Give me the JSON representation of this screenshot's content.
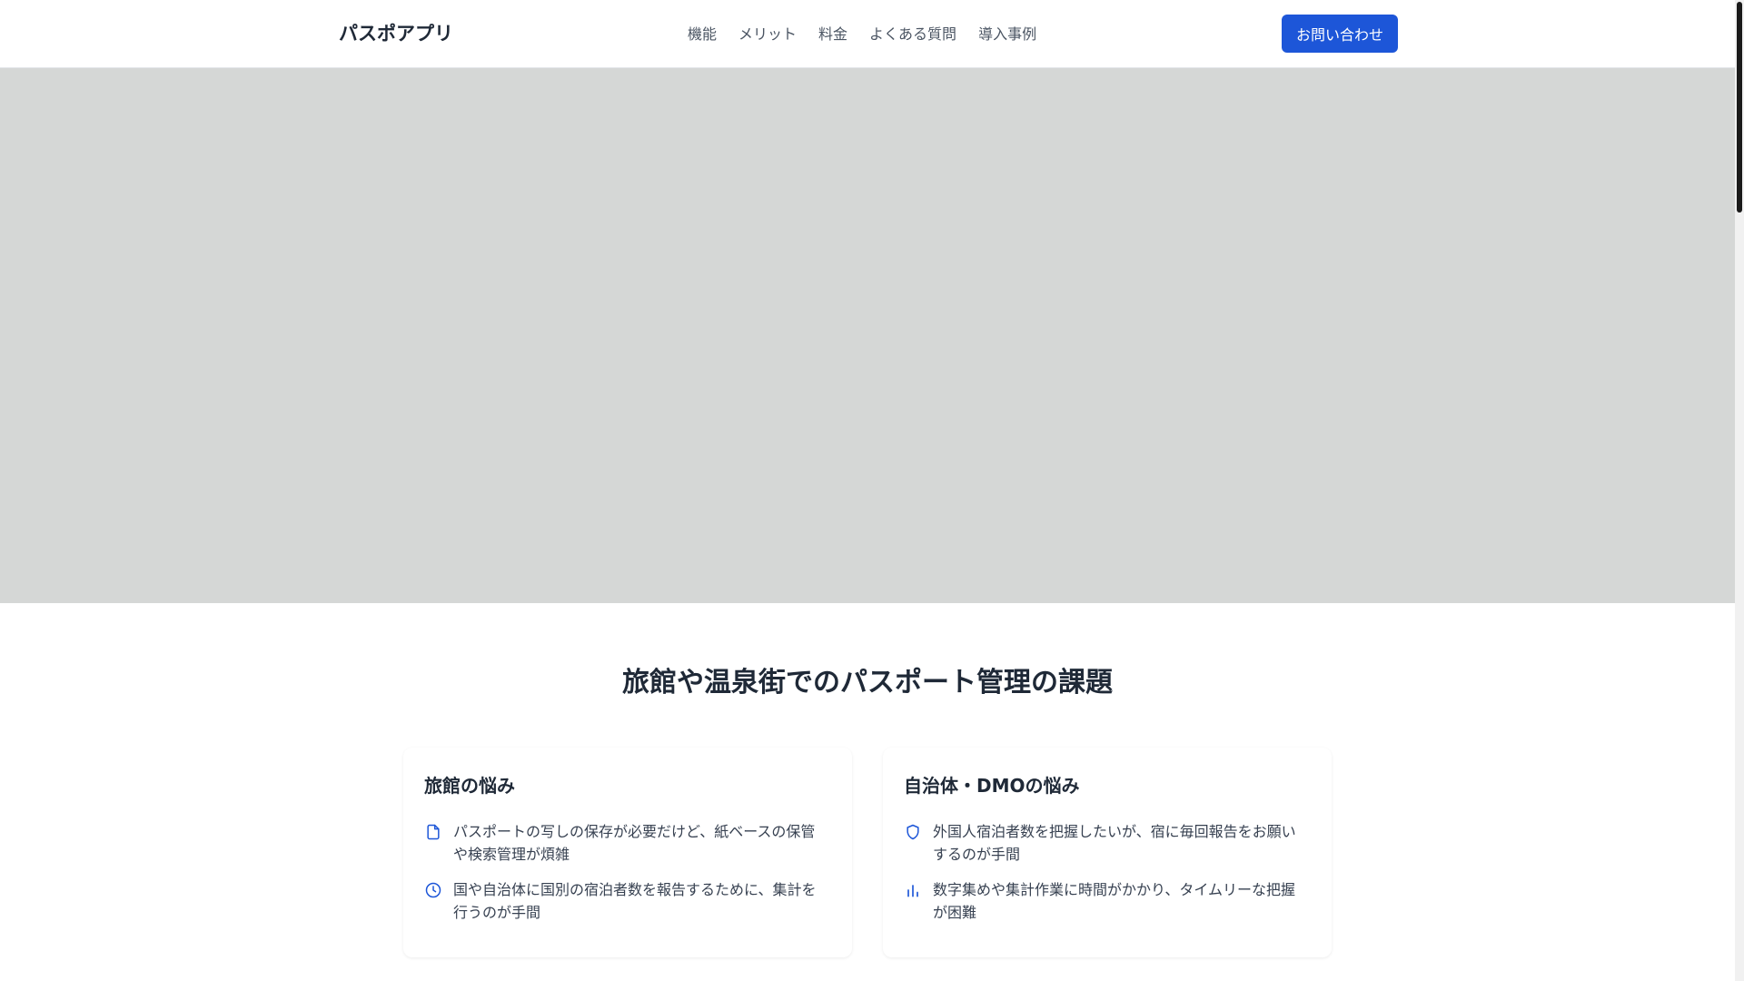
{
  "header": {
    "logo": "パスポアプリ",
    "nav": [
      "機能",
      "メリット",
      "料金",
      "よくある質問",
      "導入事例"
    ],
    "cta_label": "お問い合わせ"
  },
  "problems": {
    "title": "旅館や温泉街でのパスポート管理の課題",
    "cards": [
      {
        "title": "旅館の悩み",
        "items": [
          {
            "icon": "document-icon",
            "text": "パスポートの写しの保存が必要だけど、紙ベースの保管や検索管理が煩雑"
          },
          {
            "icon": "clock-icon",
            "text": "国や自治体に国別の宿泊者数を報告するために、集計を行うのが手間"
          }
        ]
      },
      {
        "title": "自治体・DMOの悩み",
        "items": [
          {
            "icon": "shield-icon",
            "text": "外国人宿泊者数を把握したいが、宿に毎回報告をお願いするのが手間"
          },
          {
            "icon": "bar-chart-icon",
            "text": "数字集めや集計作業に時間がかかり、タイムリーな把握が困難"
          }
        ]
      }
    ]
  },
  "colors": {
    "accent": "#1d56d8",
    "hero_placeholder": "#d5d7d6"
  }
}
